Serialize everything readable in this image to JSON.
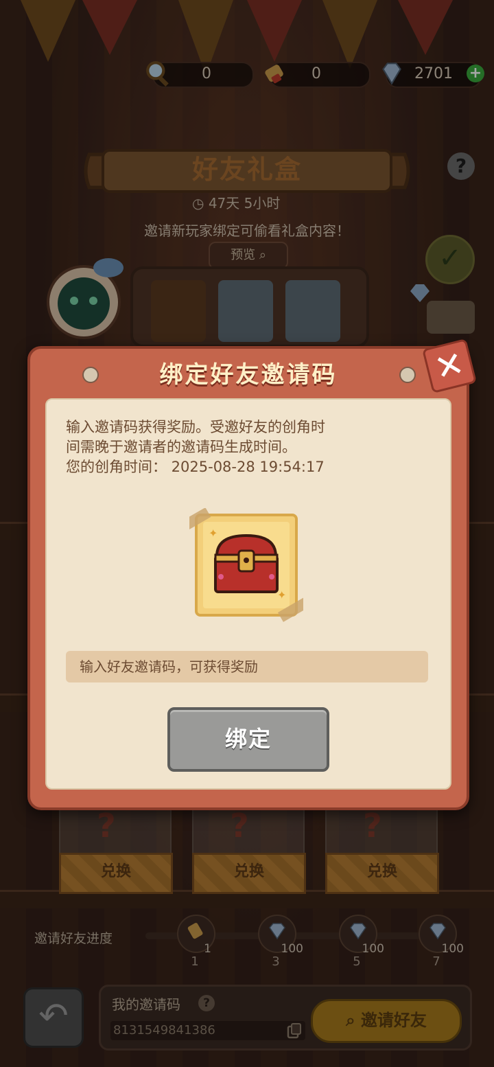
{
  "currency": {
    "magnifier_count": "0",
    "scroll_count": "0",
    "diamond_count": "2701"
  },
  "event": {
    "title": "好友礼盒",
    "timer": "47天  5小时",
    "invite_hint": "邀请新玩家绑定可偷看礼盒内容！",
    "preview_label": "预览"
  },
  "modal": {
    "title": "绑定好友邀请码",
    "description_lines": [
      "输入邀请码获得奖励。受邀好友的创角时",
      "间需晚于邀请者的邀请码生成时间。",
      "您的创角时间：  2025-08-28  19:54:17"
    ],
    "input_placeholder": "输入好友邀请码，可获得奖励",
    "bind_button": "绑定"
  },
  "boxes": {
    "redeem_label": "兑换"
  },
  "progress": {
    "label": "邀请好友进度",
    "nodes": [
      {
        "reward": "1",
        "milestone": "1"
      },
      {
        "reward": "100",
        "milestone": "3"
      },
      {
        "reward": "100",
        "milestone": "5"
      },
      {
        "reward": "100",
        "milestone": "7"
      }
    ]
  },
  "my_code": {
    "label": "我的邀请码",
    "value": "8131549841386",
    "invite_button": "邀请好友"
  },
  "colors": {
    "modal_frame": "#c4654c",
    "paper": "#f1e4cd",
    "bind_button": "#9a9a98",
    "title_text": "#fff0c8",
    "plus_green": "#3aa83d"
  }
}
